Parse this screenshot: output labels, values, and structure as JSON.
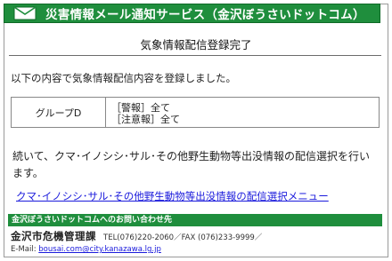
{
  "header": {
    "title": "災害情報メール通知サービス（金沢ぼうさいドットコム）",
    "icon": "mail-icon",
    "color": "#1f8e3d"
  },
  "page_title": "気象情報配信登録完了",
  "intro": "以下の内容で気象情報配信内容を登録しました。",
  "result_table": {
    "label": "グループD",
    "values": [
      "［警報］全て",
      "［注意報］全て"
    ]
  },
  "continue_text": "続いて、クマ･イノシシ･サル･その他野生動物等出没情報の配信選択を行います。",
  "menu_link": "クマ･イノシシ･サル･その他野生動物等出没情報の配信選択メニュー",
  "contact": {
    "bar_title": "金沢ぼうさいドットコムへのお問い合わせ先",
    "department": "金沢市危機管理課",
    "phone": "TEL(076)220-2060／FAX (076)233-9999／",
    "email_label": "E-Mail:",
    "email": "bousai.com@city.kanazawa.lg.jp"
  },
  "link_color": "#1a1adc"
}
